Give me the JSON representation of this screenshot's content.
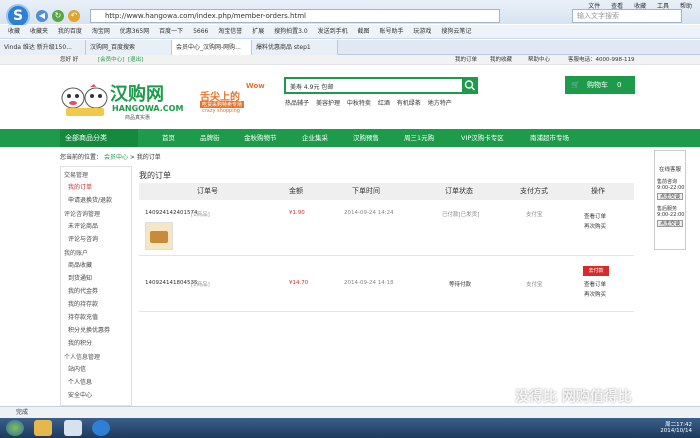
{
  "browser": {
    "menu": [
      "文件",
      "查看",
      "收藏",
      "工具",
      "帮助"
    ],
    "url": "http://www.hangowa.com/index.php/member-orders.html",
    "search_placeholder": "输入文字搜索",
    "favorites": [
      "收藏",
      "收藏夹",
      "我的百度",
      "淘宝网",
      "优惠365网",
      "百度一下",
      "5666",
      "淘宝信誉",
      "扩展",
      "搜狗拍置3.0",
      "发送到手机",
      "截图",
      "账号助手",
      "玩游戏",
      "搜狗云笔记"
    ],
    "tabs": [
      "Vinda 维达 新升级150...",
      "汉购网_百度搜索",
      "会员中心_汉购网-网购...",
      "爆料优惠商品 step1"
    ]
  },
  "site": {
    "topnav_left": "您好 好",
    "topnav_items": [
      "[会员中心]",
      "[退出]"
    ],
    "topnav_right": [
      "我的订单",
      "我的收藏",
      "帮助中心",
      "客服电话：4000-998-119"
    ],
    "logo_text": "汉购网",
    "logo_sub": "HANGOWA.COM",
    "logo_tag": "商品真实惠",
    "promo_lines": [
      "舌尖上的",
      "Wow",
      "吃货采购特卖专场",
      "crazy shopping"
    ],
    "search_value": "美寿 4.9元  包邮",
    "hot_words": [
      "热品辅子",
      "美容护理",
      "中秋特卖",
      "红酒",
      "有机绿茶",
      "地方特产"
    ],
    "cart_label": "购物车",
    "cart_count": "0",
    "all_categories": "全部商品分类",
    "nav": [
      "首页",
      "品牌街",
      "金秋购物节",
      "企业集采",
      "汉购预售",
      "周三1元购",
      "VIP汉购卡专区",
      "南浦超市专场"
    ]
  },
  "breadcrumb": {
    "prefix": "您当前的位置：",
    "items": [
      "会员中心",
      "我的订单"
    ]
  },
  "sidebar": {
    "groups": [
      {
        "title": "交易管理",
        "items": [
          "我的订单",
          "申请退换货/退款"
        ]
      },
      {
        "title": "评论咨询管理",
        "items": [
          "未评论商品",
          "评论与咨询"
        ]
      },
      {
        "title": "我的账户",
        "items": [
          "商品收藏",
          "到货通知",
          "我的代金券",
          "我的持存款",
          "持存款充值",
          "积分兑换优惠券",
          "我的积分"
        ]
      },
      {
        "title": "个人信息管理",
        "items": [
          "站内信",
          "个人信息",
          "安全中心"
        ]
      }
    ]
  },
  "orders": {
    "title": "我的订单",
    "headers": [
      "订单号",
      "金额",
      "下单时间",
      "订单状态",
      "支付方式",
      "操作"
    ],
    "rows": [
      {
        "id": "140924142401574",
        "count": "[1商品]",
        "amount": "¥1.90",
        "time": "2014-09-24 14:24",
        "status": "已付款[已发货]",
        "pay": "支付宝",
        "actions": [
          "查看订单",
          "再次购买"
        ]
      },
      {
        "id": "140924141804535",
        "count": "[1商品]",
        "amount": "¥14.70",
        "time": "2014-09-24 14:18",
        "status": "等待付款",
        "pay": "支付宝",
        "pay_button": "去付款",
        "actions": [
          "查看订单",
          "再次购买"
        ]
      }
    ]
  },
  "float_panel": {
    "title": "在线客服",
    "lines": [
      "售前咨询",
      "9:00-22:00",
      "售后服务",
      "9:00-22:00"
    ],
    "button": "点击交谈"
  },
  "status": {
    "left": "完成"
  },
  "taskbar": {
    "time": "周二17:42",
    "date": "2014/10/14"
  },
  "watermark": "没得比 网购值得比"
}
